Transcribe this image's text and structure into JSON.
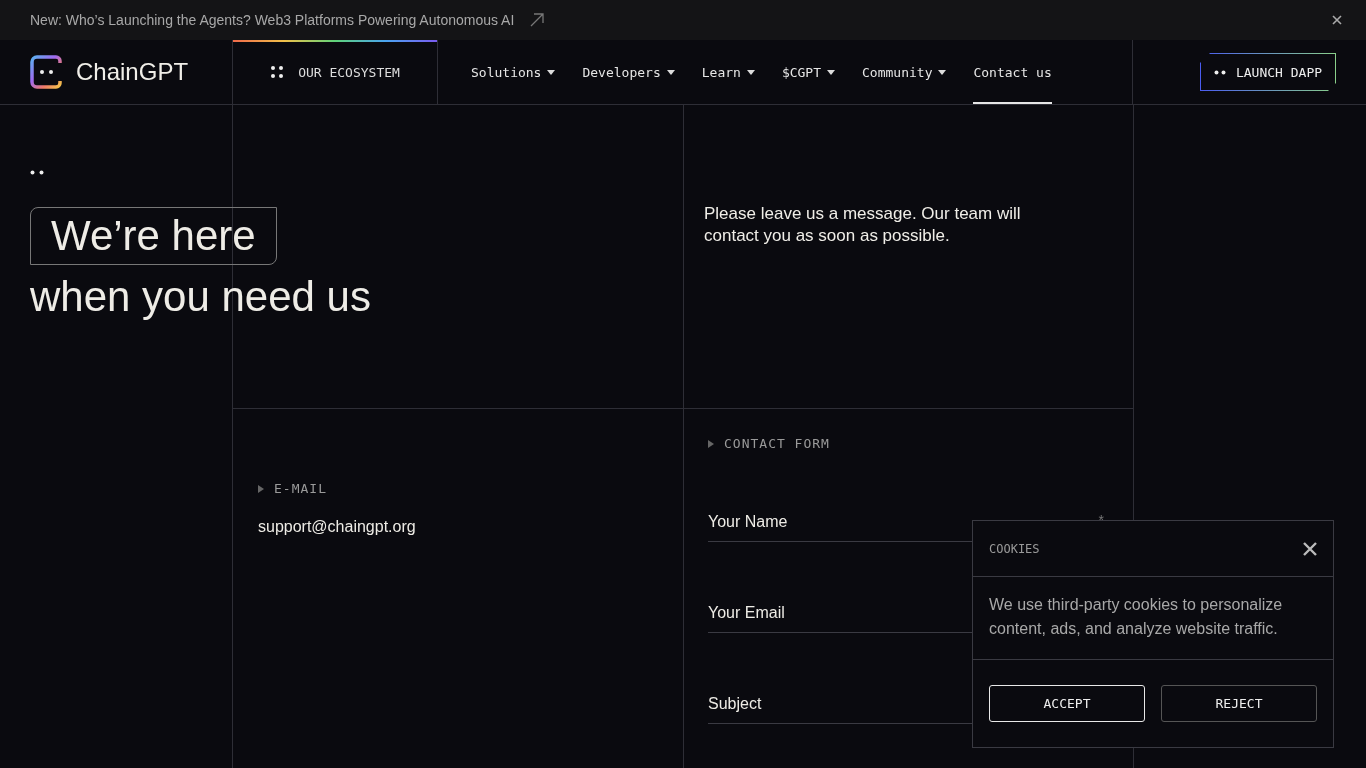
{
  "announcement": {
    "text": "New: Who’s Launching the Agents? Web3 Platforms Powering Autonomous AI"
  },
  "brand": {
    "name": "ChainGPT"
  },
  "ecosystem": {
    "label": "OUR ECOSYSTEM"
  },
  "nav": [
    {
      "label": "Solutions",
      "dropdown": true,
      "selected": false
    },
    {
      "label": "Developers",
      "dropdown": true,
      "selected": false
    },
    {
      "label": "Learn",
      "dropdown": true,
      "selected": false
    },
    {
      "label": "$CGPT",
      "dropdown": true,
      "selected": false
    },
    {
      "label": "Community",
      "dropdown": true,
      "selected": false
    },
    {
      "label": "Contact us",
      "dropdown": false,
      "selected": true
    }
  ],
  "launch_button": "LAUNCH DAPP",
  "hero": {
    "title_boxed": "We’re here",
    "title_rest": "when you need us",
    "message": "Please leave us a message. Our team will contact you as soon as possible."
  },
  "email_section": {
    "label": "E-MAIL",
    "address": "support@chaingpt.org"
  },
  "contact_form": {
    "label": "CONTACT FORM",
    "fields": [
      {
        "placeholder": "Your Name",
        "required_mark": "*"
      },
      {
        "placeholder": "Your Email"
      },
      {
        "placeholder": "Subject"
      }
    ]
  },
  "cookies": {
    "title": "COOKIES",
    "text": "We use third-party cookies to personalize content, ads, and analyze website traffic.",
    "buttons": [
      {
        "label": "ACCEPT",
        "selected": true
      },
      {
        "label": "REJECT",
        "selected": false
      }
    ]
  }
}
